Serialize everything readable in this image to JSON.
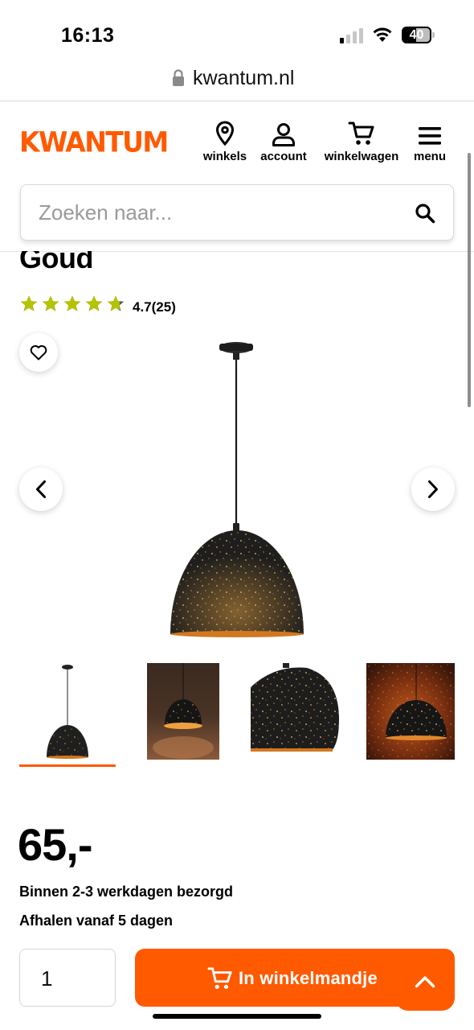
{
  "status_bar": {
    "time": "16:13",
    "battery": "40",
    "signal_bars_active": 1,
    "signal_bars_total": 4
  },
  "browser": {
    "url": "kwantum.nl"
  },
  "header": {
    "logo": "KWANTUM",
    "nav": {
      "stores": "winkels",
      "account": "account",
      "cart": "winkelwagen",
      "menu": "menu"
    }
  },
  "search": {
    "placeholder": "Zoeken naar..."
  },
  "product": {
    "title": "Goud",
    "rating_value": 4.7,
    "rating_max": 5,
    "rating_text": "4.7(25)",
    "price": "65,-",
    "delivery": "Binnen 2-3 werkdagen bezorgd",
    "pickup": "Afhalen vanaf 5 dagen",
    "thumbnails_count": 4,
    "active_thumbnail": 1
  },
  "actions": {
    "quantity": "1",
    "add_to_cart": "In winkelmandje"
  },
  "colors": {
    "brand": "#ff5a00",
    "star": "#b5c400",
    "text": "#000000"
  }
}
